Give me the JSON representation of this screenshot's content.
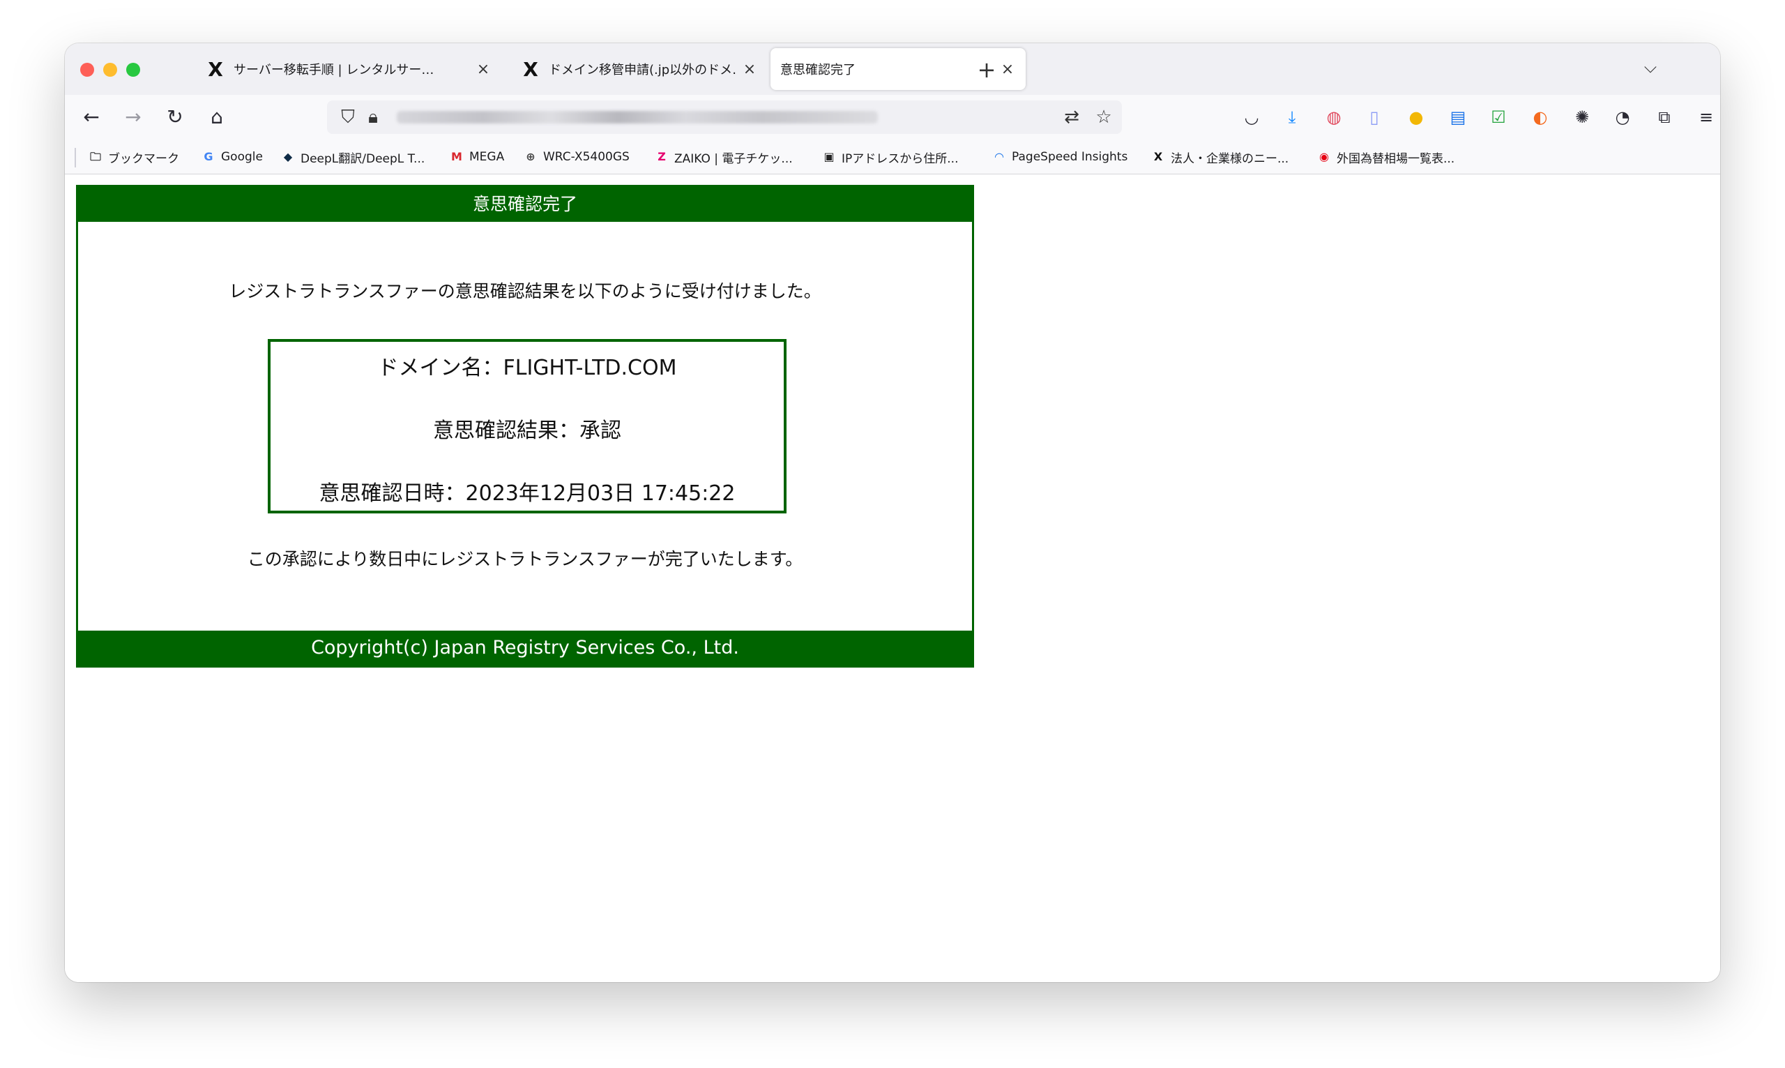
{
  "browser": {
    "tabs": [
      {
        "favicon": "X",
        "title": "サーバー移転手順 | レンタルサー…",
        "close": "×"
      },
      {
        "favicon": "X",
        "title": "ドメイン移管申請(.jp以外のドメ…",
        "close": "×"
      },
      {
        "title": "意思確認完了",
        "close": "×"
      }
    ],
    "new_tab": "+",
    "tab_list": "⌵",
    "bookmarks": [
      {
        "icon": "folder-icon",
        "glyph": "🗀",
        "label": "ブックマーク"
      },
      {
        "icon": "google-icon",
        "glyph": "G",
        "color": "#4285f4",
        "label": "Google"
      },
      {
        "icon": "deepl-icon",
        "glyph": "◆",
        "color": "#0f2b46",
        "label": "DeepL翻訳/DeepL T..."
      },
      {
        "icon": "mega-icon",
        "glyph": "M",
        "color": "#d9272e",
        "label": "MEGA"
      },
      {
        "icon": "globe-icon",
        "glyph": "⊕",
        "color": "#444444",
        "label": "WRC-X5400GS"
      },
      {
        "icon": "zaiko-icon",
        "glyph": "Z",
        "color": "#e6006e",
        "label": "ZAIKO | 電子チケッ..."
      },
      {
        "icon": "ip-icon",
        "glyph": "▣",
        "color": "#222222",
        "label": "IPアドレスから住所..."
      },
      {
        "icon": "pagespeed-icon",
        "glyph": "◠",
        "color": "#1a73e8",
        "label": "PageSpeed Insights"
      },
      {
        "icon": "x-icon",
        "glyph": "X",
        "color": "#111111",
        "label": "法人・企業様のニー..."
      },
      {
        "icon": "mufg-icon",
        "glyph": "◉",
        "color": "#e60012",
        "label": "外国為替相場一覧表..."
      }
    ]
  },
  "page": {
    "header": "意思確認完了",
    "lead": "レジストラトランスファーの意思確認結果を以下のように受け付けました。",
    "domain_line": "ドメイン名：FLIGHT-LTD.COM",
    "result_line": "意思確認結果：承認",
    "datetime_line": "意思確認日時：2023年12月03日 17:45:22",
    "follow": "この承認により数日中にレジストラトランスファーが完了いたします。",
    "footer": "Copyright(c) Japan Registry Services Co., Ltd."
  },
  "colors": {
    "brand_green": "#006400"
  }
}
